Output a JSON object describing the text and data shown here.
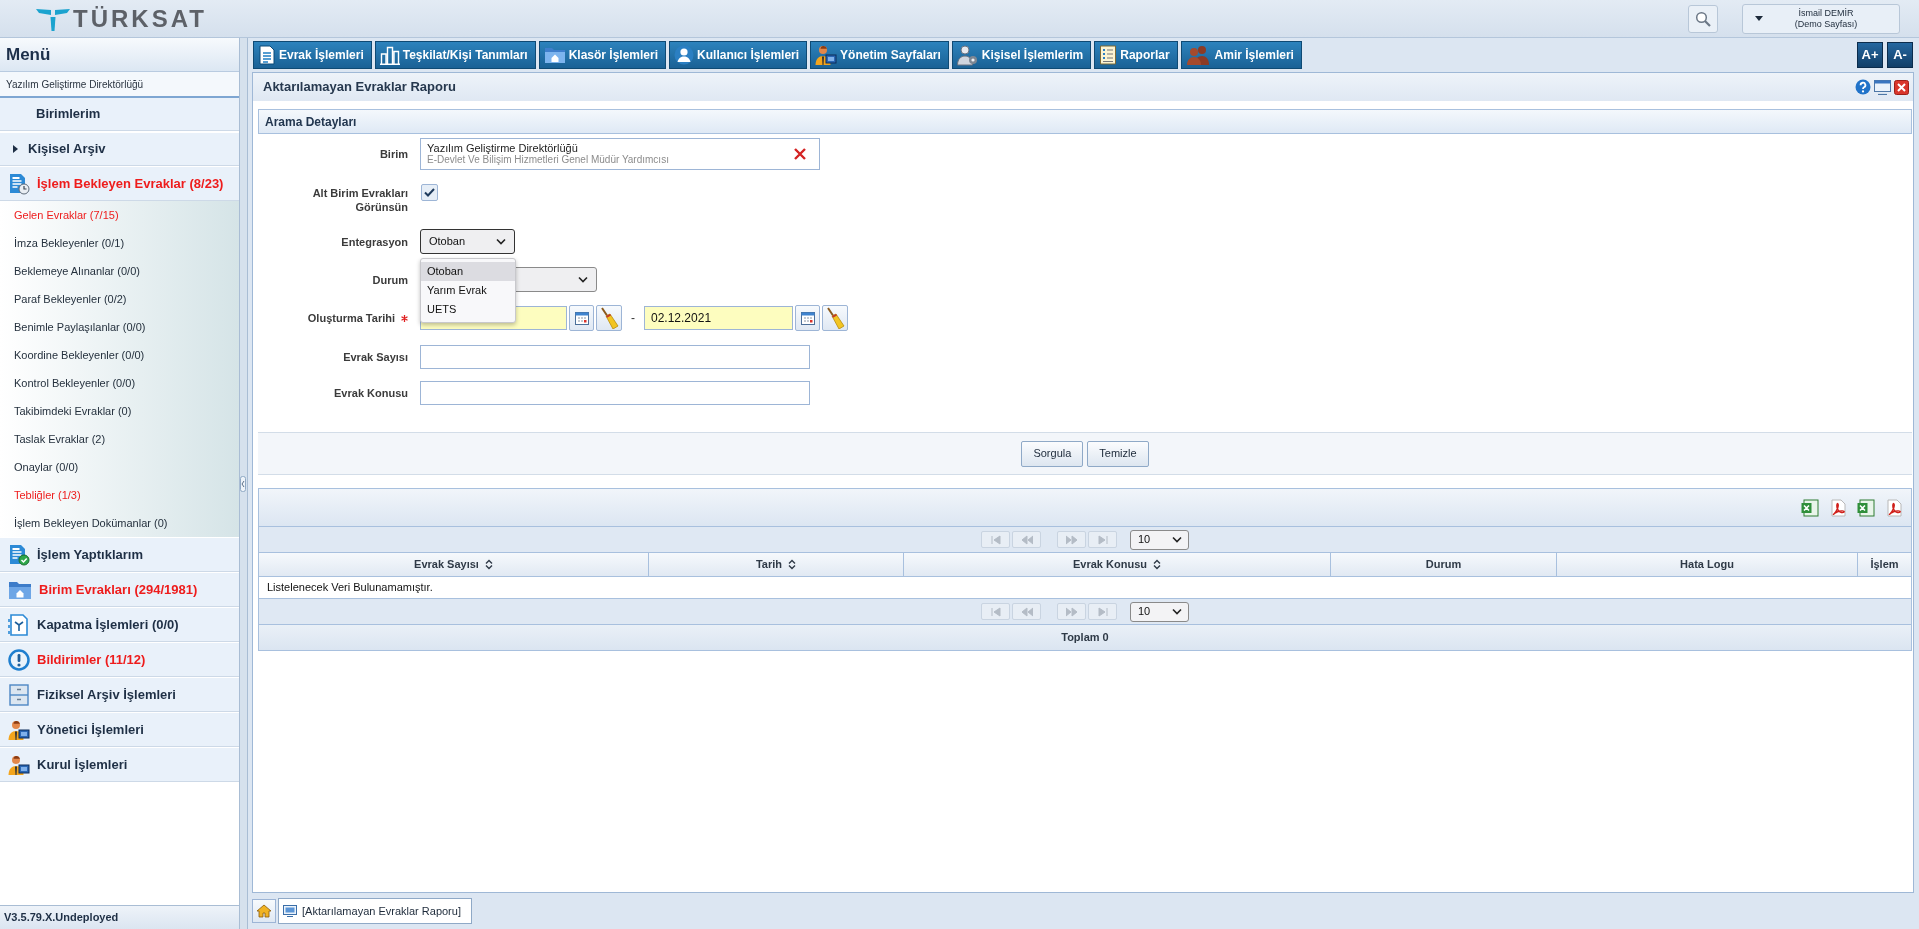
{
  "header": {
    "logo": "TÜRKSAT",
    "user_name": "İsmail DEMİR",
    "user_role": "(Demo Sayfası)"
  },
  "sidebar": {
    "title": "Menü",
    "unit": "Yazılım Geliştirme Direktörlüğü",
    "sections": [
      {
        "kind": "heading",
        "label": "Birimlerim",
        "highlighted": false
      },
      {
        "kind": "toggle",
        "label": "Kişisel Arşiv",
        "expanded": false,
        "highlighted": false
      },
      {
        "kind": "group",
        "label": "İşlem Bekleyen Evraklar (8/23)",
        "highlighted": true,
        "children": [
          {
            "label": "Gelen Evraklar (7/15)",
            "highlighted": true
          },
          {
            "label": "İmza Bekleyenler (0/1)",
            "highlighted": false
          },
          {
            "label": "Beklemeye Alınanlar (0/0)",
            "highlighted": false
          },
          {
            "label": "Paraf Bekleyenler (0/2)",
            "highlighted": false
          },
          {
            "label": "Benimle Paylaşılanlar (0/0)",
            "highlighted": false
          },
          {
            "label": "Koordine Bekleyenler (0/0)",
            "highlighted": false
          },
          {
            "label": "Kontrol Bekleyenler (0/0)",
            "highlighted": false
          },
          {
            "label": "Takibimdeki Evraklar (0)",
            "highlighted": false
          },
          {
            "label": "Taslak Evraklar (2)",
            "highlighted": false
          },
          {
            "label": "Onaylar (0/0)",
            "highlighted": false
          },
          {
            "label": "Tebliğler (1/3)",
            "highlighted": true
          },
          {
            "label": "İşlem Bekleyen Dokümanlar (0)",
            "highlighted": false
          }
        ]
      },
      {
        "kind": "group",
        "label": "İşlem Yaptıklarım",
        "highlighted": false
      },
      {
        "kind": "group",
        "label": "Birim Evrakları (294/1981)",
        "highlighted": true
      },
      {
        "kind": "group",
        "label": "Kapatma İşlemleri (0/0)",
        "highlighted": false
      },
      {
        "kind": "group",
        "label": "Bildirimler (11/12)",
        "highlighted": true
      },
      {
        "kind": "group",
        "label": "Fiziksel Arşiv İşlemleri",
        "highlighted": false
      },
      {
        "kind": "group",
        "label": "Yönetici İşlemleri",
        "highlighted": false
      },
      {
        "kind": "group",
        "label": "Kurul İşlemleri",
        "highlighted": false
      }
    ],
    "version": "V3.5.79.X.Undeployed"
  },
  "menu_bar": [
    "Evrak İşlemleri",
    "Teşkilat/Kişi Tanımları",
    "Klasör İşlemleri",
    "Kullanıcı İşlemleri",
    "Yönetim Sayfaları",
    "Kişisel İşlemlerim",
    "Raporlar",
    "Amir İşlemleri"
  ],
  "font_size_buttons": [
    "A+",
    "A-"
  ],
  "panel": {
    "title": "Aktarılamayan Evraklar Raporu",
    "search_form": {
      "title": "Arama Detayları",
      "fields": [
        {
          "kind": "unit",
          "label": "Birim",
          "value": "Yazılım Geliştirme Direktörlüğü",
          "detail": "E-Devlet Ve Bilişim Hizmetleri Genel Müdür Yardımcısı"
        },
        {
          "kind": "checkbox",
          "label": "Alt Birim Evrakları Görünsün",
          "checked": true
        },
        {
          "kind": "select",
          "label": "Entegrasyon",
          "value": "Otoban",
          "expanded": true,
          "options": [
            {
              "label": "Otoban",
              "selected": true
            },
            {
              "label": "Yarım Evrak",
              "selected": false
            },
            {
              "label": "UETS",
              "selected": false
            }
          ]
        },
        {
          "kind": "select",
          "label": "Durum",
          "expanded": false
        },
        {
          "kind": "date_range",
          "label": "Oluşturma Tarihi",
          "required": true,
          "separator": "-",
          "to": "02.12.2021"
        },
        {
          "kind": "text",
          "label": "Evrak Sayısı"
        },
        {
          "kind": "text",
          "label": "Evrak Konusu"
        }
      ],
      "buttons": [
        "Sorgula",
        "Temizle"
      ]
    },
    "results": {
      "top_pager": {
        "page_size": "10",
        "disabled": true
      },
      "columns": [
        {
          "label": "Evrak Sayısı",
          "sortable": true
        },
        {
          "label": "Tarih",
          "sortable": true
        },
        {
          "label": "Evrak Konusu",
          "sortable": true
        },
        {
          "label": "Durum",
          "sortable": false
        },
        {
          "label": "Hata Logu",
          "sortable": false
        },
        {
          "label": "İşlem",
          "sortable": false
        }
      ],
      "empty_message": "Listelenecek Veri Bulunamamıştır.",
      "bottom_pager": {
        "page_size": "10",
        "disabled": true
      },
      "total": "Toplam 0"
    }
  },
  "taskbar": {
    "tabs": [
      {
        "label": "[Aktarılamayan Evraklar Raporu]",
        "selected": true
      }
    ]
  }
}
